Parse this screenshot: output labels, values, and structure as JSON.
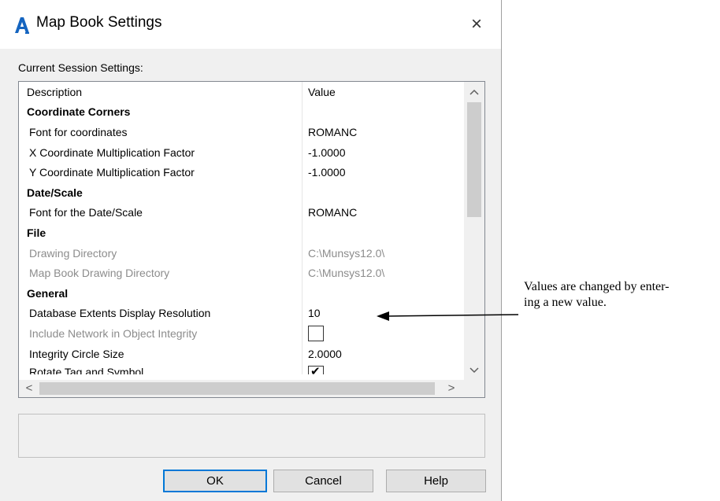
{
  "window": {
    "title": "Map Book Settings",
    "close_label": "×"
  },
  "section_label": "Current Session Settings:",
  "grid": {
    "columns": [
      "Description",
      "Value"
    ],
    "rows": [
      {
        "kind": "category",
        "description": "Coordinate Corners",
        "value": ""
      },
      {
        "kind": "item",
        "description": "Font for coordinates",
        "value": "ROMANC"
      },
      {
        "kind": "item",
        "description": "X Coordinate Multiplication Factor",
        "value": "-1.0000"
      },
      {
        "kind": "item",
        "description": "Y Coordinate Multiplication Factor",
        "value": "-1.0000"
      },
      {
        "kind": "category",
        "description": "Date/Scale",
        "value": ""
      },
      {
        "kind": "item",
        "description": "Font for the Date/Scale",
        "value": "ROMANC"
      },
      {
        "kind": "category",
        "description": "File",
        "value": ""
      },
      {
        "kind": "disabled",
        "description": "Drawing Directory",
        "value": "C:\\Munsys12.0\\"
      },
      {
        "kind": "disabled",
        "description": "Map Book Drawing Directory",
        "value": "C:\\Munsys12.0\\"
      },
      {
        "kind": "category",
        "description": "General",
        "value": ""
      },
      {
        "kind": "item",
        "description": "Database Extents Display Resolution",
        "value": "10"
      },
      {
        "kind": "disabled-checkbox",
        "description": "Include Network in Object Integrity",
        "checked": false
      },
      {
        "kind": "item",
        "description": "Integrity Circle Size",
        "value": "2.0000"
      },
      {
        "kind": "checkbox-cut",
        "description": "Rotate Tag and Symbol",
        "checked": true
      }
    ]
  },
  "buttons": {
    "ok": "OK",
    "cancel": "Cancel",
    "help": "Help"
  },
  "icons": {
    "app": "autocad-a-icon",
    "scroll_up": "▲",
    "scroll_down": "▼",
    "scroll_left": "<",
    "scroll_right": ">"
  },
  "annotation": {
    "text_line1": "Values are changed by enter-",
    "text_line2": "ing a new value."
  },
  "colors": {
    "accent": "#0078d7",
    "icon_blue": "#1565c0",
    "disabled_text": "#8c8c8c"
  }
}
